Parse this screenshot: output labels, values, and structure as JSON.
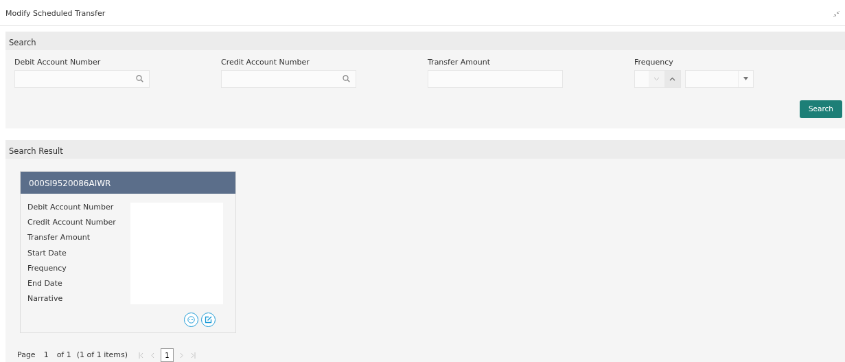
{
  "page_title": "Modify Scheduled Transfer",
  "search": {
    "title": "Search",
    "fields": [
      {
        "kind": "lookup",
        "label": "Debit Account Number"
      },
      {
        "kind": "lookup",
        "label": "Credit Account Number"
      },
      {
        "kind": "text",
        "label": "Transfer Amount"
      },
      {
        "kind": "frequency",
        "label": "Frequency"
      }
    ],
    "button": "Search"
  },
  "results": {
    "title": "Search Result",
    "cards": [
      {
        "title": "000SI9520086AIWR",
        "labels": [
          "Debit Account Number",
          "Credit Account Number",
          "Transfer Amount",
          "Start Date",
          "Frequency",
          "End Date",
          "Narrative"
        ]
      }
    ]
  },
  "pagination": {
    "page_label": "Page",
    "page": "1",
    "of_pages": "of 1",
    "items": "(1 of 1 items)",
    "pages": [
      {
        "label": "1",
        "selected": true
      }
    ]
  }
}
